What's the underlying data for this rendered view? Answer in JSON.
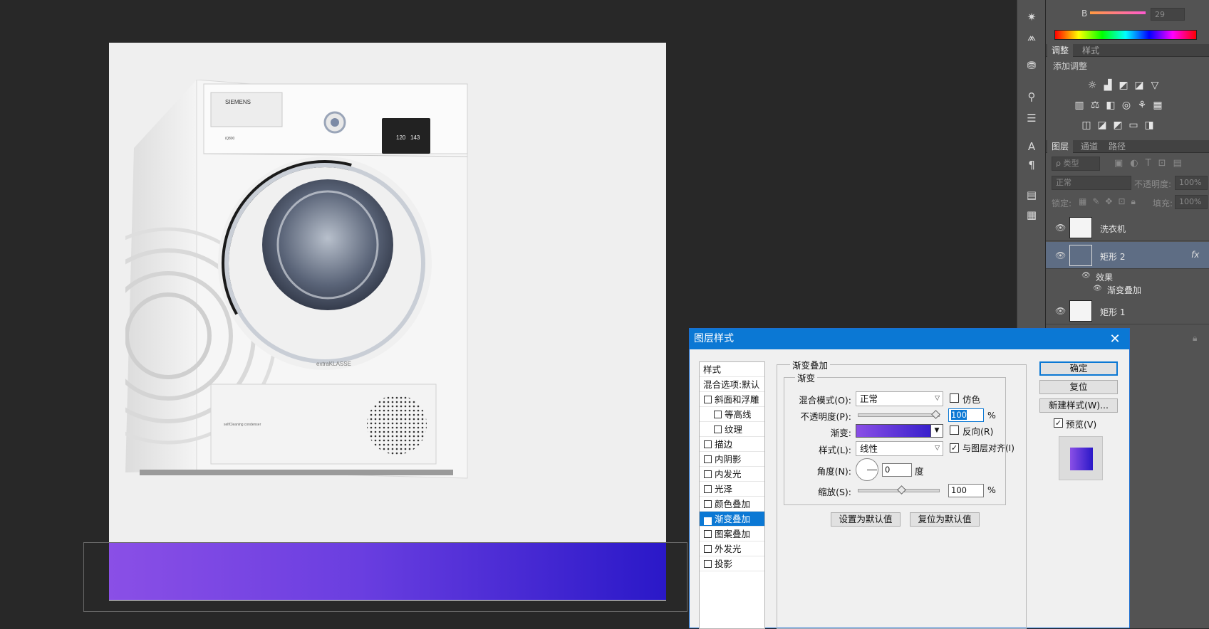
{
  "panels": {
    "color": {
      "channel_b_label": "B",
      "channel_b_value": "29"
    },
    "adjust": {
      "tabs": [
        "调整",
        "样式"
      ],
      "add_label": "添加调整",
      "icons": [
        "brightness-icon",
        "levels-icon",
        "curves-icon",
        "exposure-icon",
        "vibrance-icon",
        "hue-sat-icon",
        "color-balance-icon",
        "bw-icon",
        "photo-filter-icon",
        "channel-mixer-icon",
        "color-lookup-icon",
        "invert-icon",
        "posterize-icon",
        "threshold-icon",
        "gradient-map-icon",
        "selective-color-icon"
      ]
    },
    "layers": {
      "tabs": [
        "图层",
        "通道",
        "路径"
      ],
      "filter_kind": "ρ 类型",
      "blend_mode": "正常",
      "opacity_label": "不透明度:",
      "opacity_value": "100%",
      "lock_label": "锁定:",
      "fill_label": "填充:",
      "fill_value": "100%",
      "items": [
        {
          "name": "洗衣机",
          "selected": false
        },
        {
          "name": "矩形 2",
          "selected": true,
          "fx": "fx"
        },
        {
          "name": "矩形 1",
          "selected": false
        }
      ],
      "effects_label": "效果",
      "effect_item": "渐变叠加"
    }
  },
  "canvas": {
    "product": {
      "brand": "SIEMENS",
      "model": "iQ800",
      "series": "extraKLASSE",
      "feature": "selfCleaning condenser",
      "display_time": "120",
      "display_value": "143"
    },
    "gradient": {
      "start": "#8a4fe6",
      "end": "#2a18c8"
    }
  },
  "dialog": {
    "title": "图层样式",
    "close": "✕",
    "styles_header": "样式",
    "blend_options": "混合选项:默认",
    "styles": [
      {
        "label": "斜面和浮雕",
        "checked": false,
        "indent": false
      },
      {
        "label": "等高线",
        "checked": false,
        "indent": true
      },
      {
        "label": "纹理",
        "checked": false,
        "indent": true
      },
      {
        "label": "描边",
        "checked": false,
        "indent": false
      },
      {
        "label": "内阴影",
        "checked": false,
        "indent": false
      },
      {
        "label": "内发光",
        "checked": false,
        "indent": false
      },
      {
        "label": "光泽",
        "checked": false,
        "indent": false
      },
      {
        "label": "颜色叠加",
        "checked": false,
        "indent": false
      },
      {
        "label": "渐变叠加",
        "checked": true,
        "indent": false,
        "selected": true
      },
      {
        "label": "图案叠加",
        "checked": false,
        "indent": false
      },
      {
        "label": "外发光",
        "checked": false,
        "indent": false
      },
      {
        "label": "投影",
        "checked": false,
        "indent": false
      }
    ],
    "section_title": "渐变叠加",
    "group_title": "渐变",
    "blend_mode_label": "混合模式(O):",
    "blend_mode_value": "正常",
    "dither_label": "仿色",
    "opacity_label": "不透明度(P):",
    "opacity_value": "100",
    "percent": "%",
    "gradient_label": "渐变:",
    "reverse_label": "反向(R)",
    "style_label": "样式(L):",
    "style_value": "线性",
    "align_label": "与图层对齐(I)",
    "angle_label": "角度(N):",
    "angle_value": "0",
    "degree": "度",
    "scale_label": "缩放(S):",
    "scale_value": "100",
    "set_default": "设置为默认值",
    "reset_default": "复位为默认值",
    "ok": "确定",
    "reset": "复位",
    "new_style": "新建样式(W)...",
    "preview_label": "预览(V)"
  }
}
